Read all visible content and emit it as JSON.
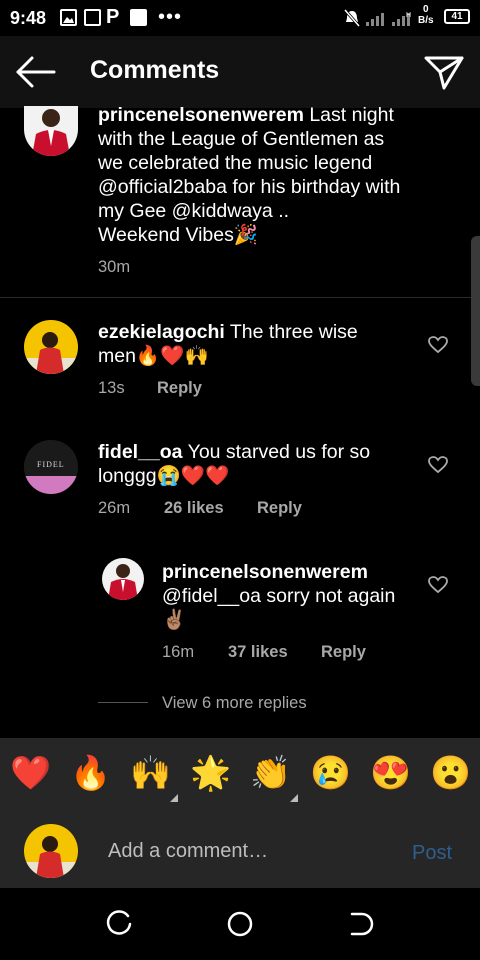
{
  "status": {
    "time": "9:48",
    "net_speed_value": "0",
    "net_speed_unit": "B/s",
    "battery": "41"
  },
  "header": {
    "title": "Comments",
    "back_icon": "arrow-left-icon",
    "send_icon": "paper-plane-icon"
  },
  "caption": {
    "username": "princenelsonenwerem",
    "line1": "Last night",
    "line2": "with the League of Gentlemen  as",
    "line3": "we celebrated the music legend",
    "line4": "@official2baba for his birthday with",
    "line5": "my Gee @kiddwaya ..",
    "line6": "Weekend Vibes🎉",
    "time": "30m"
  },
  "comments": [
    {
      "username": "ezekielagochi",
      "line1": " The three wise",
      "line2": "men🔥❤️🙌",
      "time": "13s",
      "reply": "Reply"
    },
    {
      "username": "fidel__oa",
      "line1": " You starved us for so",
      "line2": "longgg😭❤️❤️",
      "time": "26m",
      "likes": "26 likes",
      "reply": "Reply",
      "avatar_text": "FIDEL"
    }
  ],
  "reply_comment": {
    "username": "princenelsonenwerem",
    "line1": "@fidel__oa sorry not again",
    "line2": "✌🏽",
    "time": "16m",
    "likes": "37 likes",
    "reply": "Reply"
  },
  "view_more": "View 6 more replies",
  "emoji_bar": [
    "❤️",
    "🔥",
    "🙌",
    "🌟",
    "👏",
    "😢",
    "😍",
    "😮"
  ],
  "composer": {
    "placeholder": "Add a comment…",
    "post": "Post"
  },
  "colors": {
    "accent_link": "#2e5f8e",
    "panel": "#262626",
    "header": "#121212"
  }
}
